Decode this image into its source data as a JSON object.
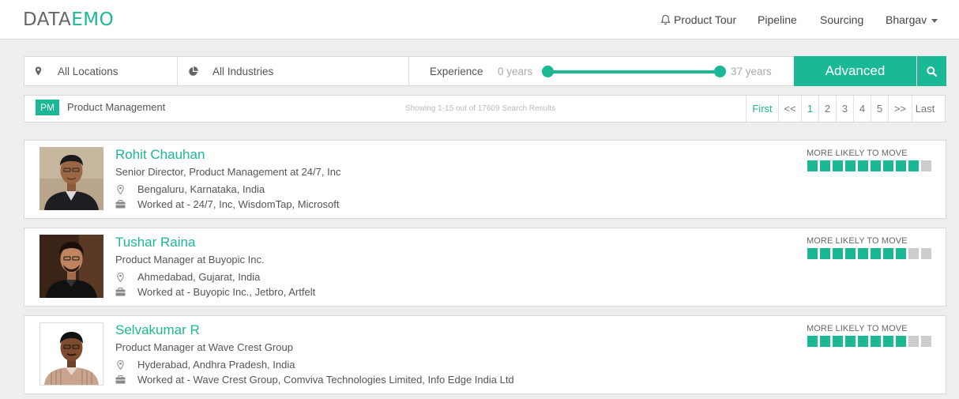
{
  "brand": {
    "part1": "DATA",
    "part2": "EMO"
  },
  "nav": {
    "product_tour": "Product Tour",
    "pipeline": "Pipeline",
    "sourcing": "Sourcing",
    "user": "Bhargav"
  },
  "filters": {
    "location": "All Locations",
    "industry": "All Industries",
    "experience_label": "Experience",
    "min_years": "0 years",
    "max_years": "37 years",
    "advanced": "Advanced"
  },
  "results": {
    "badge": "PM",
    "label": "Product Management",
    "showing": "Showing 1-15 out of 17609 Search Results",
    "pager": [
      "First",
      "<<",
      "1",
      "2",
      "3",
      "4",
      "5",
      ">>",
      "Last"
    ],
    "current_page": "1"
  },
  "colors": {
    "accent": "#1bb895",
    "inactive": "#cccccc"
  },
  "candidates": [
    {
      "name": "Rohit Chauhan",
      "title": "Senior Director, Product Management at 24/7, Inc",
      "location": "Bengaluru, Karnataka, India",
      "worked": "Worked at - 24/7, Inc, WisdomTap, Microsoft",
      "move_label": "MORE LIKELY TO MOVE",
      "move_score": 9,
      "move_max": 10
    },
    {
      "name": "Tushar Raina",
      "title": "Product Manager at Buyopic Inc.",
      "location": "Ahmedabad, Gujarat, India",
      "worked": "Worked at - Buyopic Inc., Jetbro, Artfelt",
      "move_label": "MORE LIKELY TO MOVE",
      "move_score": 8,
      "move_max": 10
    },
    {
      "name": "Selvakumar R",
      "title": "Product Manager at Wave Crest Group",
      "location": "Hyderabad, Andhra Pradesh, India",
      "worked": "Worked at - Wave Crest Group, Comviva Technologies Limited, Info Edge India Ltd",
      "move_label": "MORE LIKELY TO MOVE",
      "move_score": 8,
      "move_max": 10
    }
  ]
}
